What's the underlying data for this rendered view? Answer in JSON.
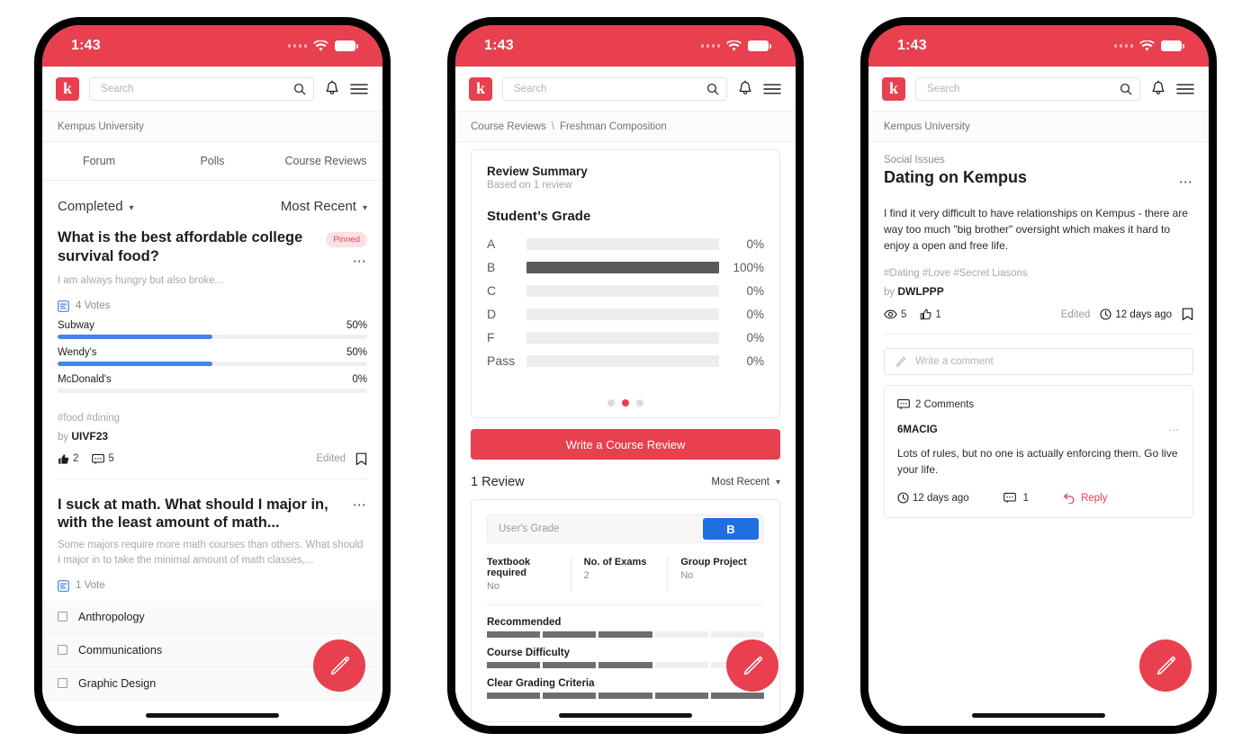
{
  "brand": {
    "accent": "#E8404F",
    "blue": "#4285E8",
    "badge_blue": "#1F6FE0",
    "logo_letter": "k"
  },
  "status": {
    "time": "1:43"
  },
  "search": {
    "placeholder": "Search"
  },
  "phone1": {
    "breadcrumb": "Kempus University",
    "tabs": [
      {
        "label": "Forum"
      },
      {
        "label": "Polls"
      },
      {
        "label": "Course Reviews"
      }
    ],
    "filter_left": "Completed",
    "filter_right": "Most Recent",
    "posts": [
      {
        "title": "What is the best affordable college survival food?",
        "badge": "Pinned",
        "subtitle": "I am always hungry but also broke...",
        "votes": "4 Votes",
        "options": [
          {
            "label": "Subway",
            "pct": "50%",
            "value": 50
          },
          {
            "label": "Wendy's",
            "pct": "50%",
            "value": 50
          },
          {
            "label": "McDonald's",
            "pct": "0%",
            "value": 0
          }
        ],
        "tags": "#food #dining",
        "by_label": "by",
        "author": "UIVF23",
        "likes": "2",
        "comments": "5",
        "edited": "Edited"
      },
      {
        "title": "I suck at math. What should I major in, with the least amount of math...",
        "subtitle": "Some majors require more math courses than others. What should I major in to take the minimal amount of math classes,...",
        "votes": "1 Vote",
        "choices": [
          {
            "label": "Anthropology"
          },
          {
            "label": "Communications"
          },
          {
            "label": "Graphic Design"
          }
        ]
      }
    ]
  },
  "phone2": {
    "breadcrumb_root": "Course Reviews",
    "breadcrumb_sep": "\\",
    "breadcrumb_leaf": "Freshman Composition",
    "summary": {
      "title": "Review Summary",
      "subtitle": "Based on 1 review",
      "section": "Student’s Grade"
    },
    "pager": {
      "count": 3,
      "active": 1
    },
    "cta": "Write a Course Review",
    "review_count": "1 Review",
    "sort": "Most Recent",
    "review": {
      "grade_label": "User's Grade",
      "grade_value": "B",
      "facts": [
        {
          "k": "Textbook required",
          "v": "No"
        },
        {
          "k": "No. of Exams",
          "v": "2"
        },
        {
          "k": "Group Project",
          "v": "No"
        }
      ],
      "ratings": [
        {
          "label": "Recommended",
          "value": 3,
          "max": 5
        },
        {
          "label": "Course Difficulty",
          "value": 3,
          "max": 5
        },
        {
          "label": "Clear Grading Criteria",
          "value": 5,
          "max": 5
        }
      ]
    },
    "chart_data": {
      "type": "bar",
      "title": "Student’s Grade",
      "subtitle": "Based on 1 review",
      "orientation": "horizontal",
      "categories": [
        "A",
        "B",
        "C",
        "D",
        "F",
        "Pass"
      ],
      "values": [
        0,
        100,
        0,
        0,
        0,
        0
      ],
      "value_labels": [
        "0%",
        "100%",
        "0%",
        "0%",
        "0%",
        "0%"
      ],
      "xlabel": "",
      "ylabel": "",
      "xlim": [
        0,
        100
      ],
      "grid": false,
      "legend": false,
      "bar_color": "#5a5a5a",
      "track_color": "#ededed"
    }
  },
  "phone3": {
    "breadcrumb": "Kempus University",
    "kicker": "Social Issues",
    "title": "Dating on Kempus",
    "body": "I find it very difficult to have relationships on Kempus - there are way too much \"big brother\" oversight which makes it hard to enjoy a open and free life.",
    "tags": "#Dating #Love #Secret Liasons",
    "by_label": "by",
    "author": "DWLPPP",
    "views": "5",
    "likes": "1",
    "edited": "Edited",
    "time": "12 days ago",
    "comment_placeholder": "Write a comment",
    "comments_header": "2 Comments",
    "comment": {
      "author": "6MACIG",
      "text": "Lots of rules, but no one is actually enforcing them. Go live your life.",
      "time": "12 days ago",
      "replies": "1",
      "reply_label": "Reply"
    }
  },
  "icons": {
    "search": "search-icon",
    "bell": "bell-icon",
    "menu": "hamburger-menu-icon",
    "poll": "poll-icon",
    "bookmark": "bookmark-icon",
    "pencil": "pencil-icon"
  }
}
